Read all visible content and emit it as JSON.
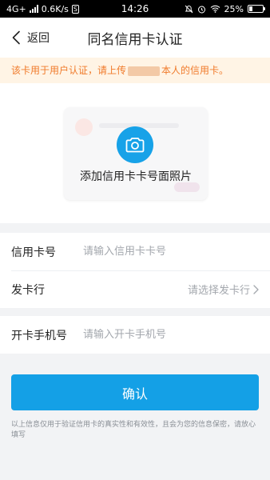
{
  "status_bar": {
    "network": "4G+",
    "speed": "0.6K/s",
    "badge": "S",
    "time": "14:26",
    "battery": "25%",
    "battery_level": 0.25
  },
  "nav": {
    "back_label": "返回",
    "title": "同名信用卡认证"
  },
  "notice": {
    "text_before": "该卡用于用户认证，请上传",
    "text_after": "本人的信用卡。"
  },
  "upload": {
    "label": "添加信用卡卡号面照片"
  },
  "form": {
    "card_number": {
      "label": "信用卡号",
      "placeholder": "请输入信用卡卡号",
      "value": ""
    },
    "issuer": {
      "label": "发卡行",
      "placeholder": "请选择发卡行"
    },
    "phone": {
      "label": "开卡手机号",
      "placeholder": "请输入开卡手机号",
      "value": ""
    }
  },
  "confirm": {
    "label": "确认"
  },
  "footnote": {
    "text": "以上信息仅用于验证信用卡的真实性和有效性，且会为您的信息保密，请放心填写"
  },
  "colors": {
    "accent": "#14a0e6",
    "notice_text": "#f07a2a",
    "notice_bg": "#fff4e5"
  }
}
